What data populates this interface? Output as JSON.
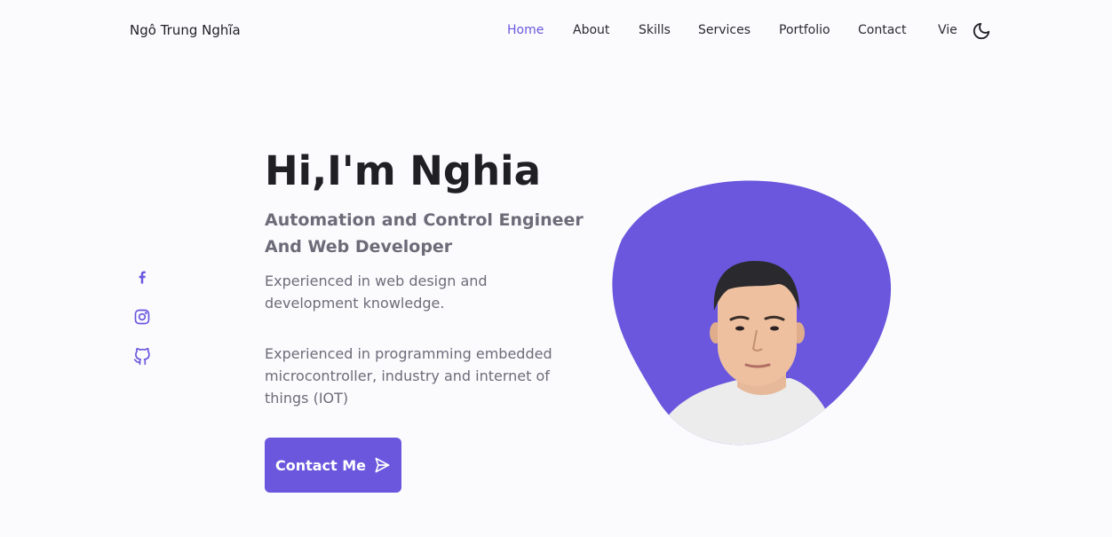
{
  "header": {
    "logo": "Ngô Trung Nghĩa",
    "nav": [
      {
        "label": "Home",
        "active": true
      },
      {
        "label": "About",
        "active": false
      },
      {
        "label": "Skills",
        "active": false
      },
      {
        "label": "Services",
        "active": false
      },
      {
        "label": "Portfolio",
        "active": false
      },
      {
        "label": "Contact",
        "active": false
      }
    ],
    "language_label": "Vie",
    "theme_icon": "moon-icon"
  },
  "social": {
    "items": [
      {
        "icon": "facebook-icon"
      },
      {
        "icon": "instagram-icon"
      },
      {
        "icon": "github-icon"
      }
    ]
  },
  "hero": {
    "title": "Hi,I'm Nghia",
    "subtitle": "Automation and Control Engineer And Web Developer",
    "description_1": "Experienced in web design and development knowledge.",
    "description_2": "Experienced in programming embedded microcontroller, industry and internet of things (IOT)",
    "cta_label": "Contact Me",
    "cta_icon": "send-icon"
  },
  "colors": {
    "accent": "#6a57dd",
    "text": "#1f1f24",
    "muted": "#6e6b78",
    "background": "#fbfbfe"
  }
}
